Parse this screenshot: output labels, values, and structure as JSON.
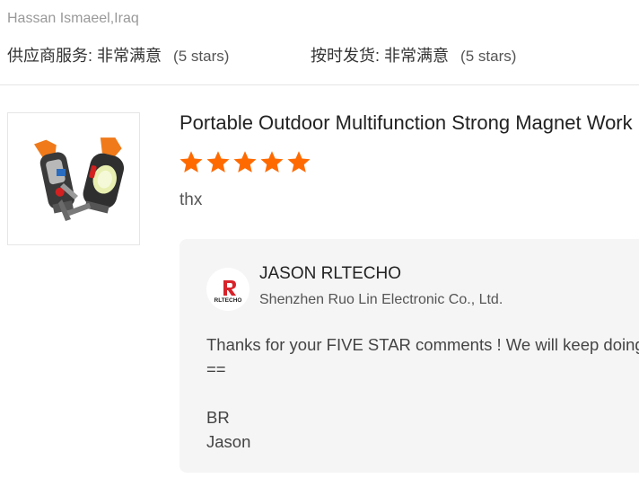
{
  "reviewer": {
    "name": "Hassan Ismaeel,Iraq"
  },
  "ratings": [
    {
      "label": "供应商服务:",
      "value": "非常满意",
      "stars_text": "(5 stars)"
    },
    {
      "label": "按时发货:",
      "value": "非常满意",
      "stars_text": "(5 stars)"
    }
  ],
  "product": {
    "title": "Portable Outdoor Multifunction Strong Magnet Work Light",
    "rating": 5,
    "star_color": "#ff6a00",
    "comment": "thx"
  },
  "reply": {
    "logo_text": "RLTECHO",
    "seller_name": "JASON RLTECHO",
    "company": "Shenzhen Ruo Lin Electronic Co., Ltd.",
    "lines": [
      "Thanks for your FIVE STAR comments ! We will keep doing our best ~",
      "==",
      "",
      "BR",
      "Jason"
    ]
  }
}
